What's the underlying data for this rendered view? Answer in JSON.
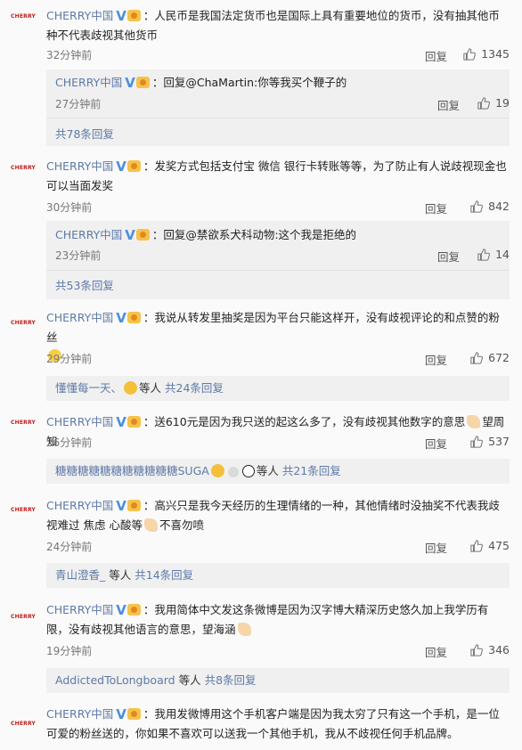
{
  "comments": [
    {
      "avatar_text": "CHERRY",
      "username": "CHERRY中国",
      "text": "：人民币是我国法定货币也是国际上具有重要地位的货币，没有抽其他币种不代表歧视其他货币",
      "time": "32分钟前",
      "reply_label": "回复",
      "likes": "1345",
      "sub_reply": {
        "username": "CHERRY中国",
        "text": "：回复@ChaMartin:你等我买个鞭子的",
        "time": "27分钟前",
        "reply_label": "回复",
        "likes": "19"
      },
      "more_replies": "共78条回复"
    },
    {
      "avatar_text": "CHERRY",
      "username": "CHERRY中国",
      "text": "：发奖方式包括支付宝 微信 银行卡转账等等，为了防止有人说歧视现金也可以当面发奖",
      "time": "30分钟前",
      "reply_label": "回复",
      "likes": "842",
      "sub_reply": {
        "username": "CHERRY中国",
        "text": "：回复@禁欲系犬科动物:这个我是拒绝的",
        "time": "23分钟前",
        "reply_label": "回复",
        "likes": "14"
      },
      "more_replies": "共53条回复"
    },
    {
      "avatar_text": "CHERRY",
      "username": "CHERRY中国",
      "text": "：我说从转发里抽奖是因为平台只能这样开，没有歧视评论的和点赞的粉丝",
      "time": "29分钟前",
      "reply_label": "回复",
      "likes": "672",
      "summary": {
        "names": "懂懂每一天、",
        "etc": "等人",
        "count": "共24条回复"
      }
    },
    {
      "avatar_text": "CHERRY",
      "username": "CHERRY中国",
      "text": "：送610元是因为我只送的起这么多了，没有歧视其他数字的意思",
      "text_tail": "望周知",
      "time": "26分钟前",
      "reply_label": "回复",
      "likes": "537",
      "summary": {
        "names": "糖糖糖糖糖糖糖糖糖糖糖SUGA",
        "etc": "等人",
        "count": "共21条回复"
      }
    },
    {
      "avatar_text": "CHERRY",
      "username": "CHERRY中国",
      "text": "：高兴只是我今天经历的生理情绪的一种，其他情绪时没抽奖不代表我歧视难过 焦虑 心酸等",
      "text_tail": "不喜勿喷",
      "time": "24分钟前",
      "reply_label": "回复",
      "likes": "475",
      "summary": {
        "names": "青山澄香_",
        "etc": "等人",
        "count": "共14条回复"
      }
    },
    {
      "avatar_text": "CHERRY",
      "username": "CHERRY中国",
      "text": "：我用简体中文发这条微博是因为汉字博大精深历史悠久加上我学历有限，没有歧视其他语言的意思，望海涵",
      "time": "19分钟前",
      "reply_label": "回复",
      "likes": "346",
      "summary": {
        "names": "AddictedToLongboard",
        "etc": "等人",
        "count": "共8条回复"
      }
    },
    {
      "avatar_text": "CHERRY",
      "username": "CHERRY中国",
      "text": "：我用发微博用这个手机客户端是因为我太穷了只有这一个手机，是一位可爱的粉丝送的，你如果不喜欢可以送我一个其他手机，我从不歧视任何手机品牌。"
    }
  ],
  "colors": {
    "username": "#5d7aa8",
    "verified": "#4a8fe0",
    "brand": "#c41a1a"
  },
  "icons": [
    "verified-v-icon",
    "level-badge-icon",
    "thumb-up-icon",
    "sad-emoji-icon",
    "laugh-emoji-icon",
    "hands-emoji-icon",
    "ring-emoji-icon",
    "panda-emoji-icon"
  ]
}
